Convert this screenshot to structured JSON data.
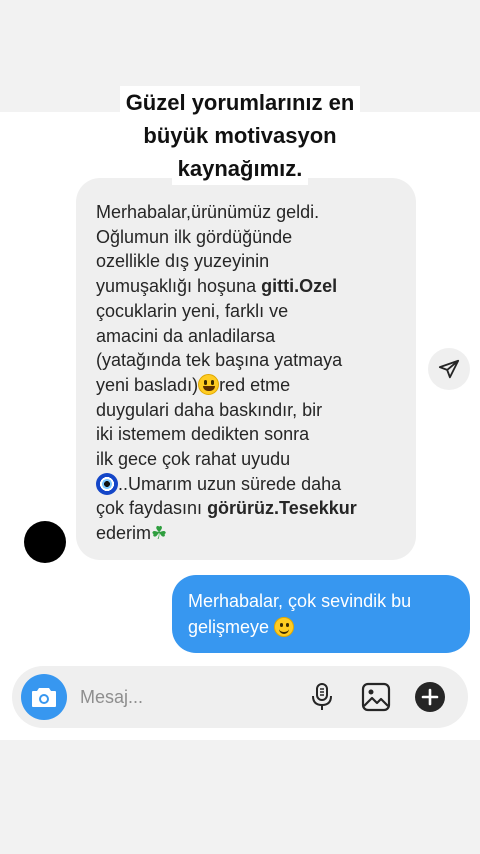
{
  "caption": {
    "lines": [
      "Güzel yorumlarınız en",
      "büyük motivasyon",
      "kaynağımız."
    ]
  },
  "received_message": {
    "lines": [
      [
        {
          "t": "Merhabalar,ürünümüz geldi."
        }
      ],
      [
        {
          "t": "Oğlumun ilk gördüğünde"
        }
      ],
      [
        {
          "t": "ozellikle dış yuzeyinin"
        }
      ],
      [
        {
          "t": "yumuşaklığı hoşuna "
        },
        {
          "t": "gitti.Ozel",
          "b": true
        }
      ],
      [
        {
          "t": "çocuklarin yeni, farklı ve"
        }
      ],
      [
        {
          "t": "amacini da anladilarsa"
        }
      ],
      [
        {
          "t": "(yatağında tek başına yatmaya"
        }
      ],
      [
        {
          "t": "yeni basladı)"
        },
        {
          "emoji": "grinning-face"
        },
        {
          "t": "red etme"
        }
      ],
      [
        {
          "t": "duygulari daha baskındır, bir"
        }
      ],
      [
        {
          "t": "iki istemem dedikten  sonra"
        }
      ],
      [
        {
          "t": "ilk gece çok rahat uyudu"
        }
      ],
      [
        {
          "emoji": "nazar-amulet"
        },
        {
          "t": "..Umarım uzun sürede daha"
        }
      ],
      [
        {
          "t": "çok faydasını "
        },
        {
          "t": "görürüz.Tesekkur",
          "b": true
        }
      ],
      [
        {
          "t": "ederim"
        },
        {
          "emoji": "four-leaf-clover"
        }
      ]
    ]
  },
  "sent_message": {
    "line1": "Merhabalar, çok sevindik bu",
    "line2": "gelişmeye",
    "emoji": "slightly-smiling-face"
  },
  "composer": {
    "placeholder": "Mesaj...",
    "icons": [
      "camera-icon",
      "microphone-icon",
      "gallery-icon",
      "add-icon"
    ]
  },
  "share_icon": "send-icon",
  "colors": {
    "accent": "#3797f0",
    "received_bubble": "#efefef",
    "sent_text": "#ffffff"
  }
}
